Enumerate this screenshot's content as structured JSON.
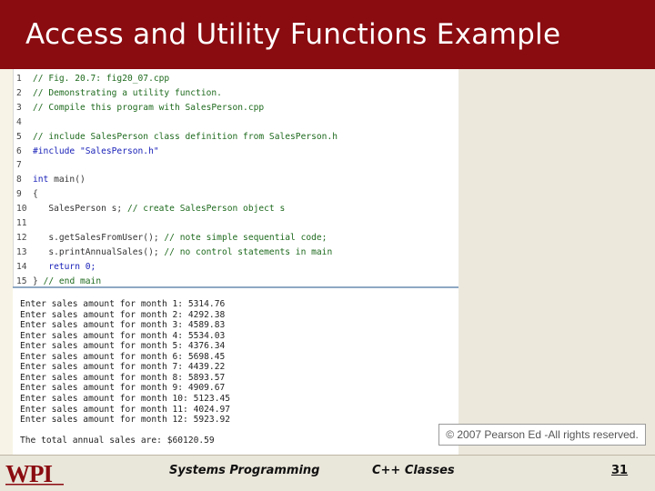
{
  "slide": {
    "title": "Access and Utility Functions Example"
  },
  "code": {
    "lines": [
      {
        "num": "1",
        "text": "// Fig. 20.7: fig20_07.cpp",
        "kind": "comment"
      },
      {
        "num": "2",
        "text": "// Demonstrating a utility function.",
        "kind": "comment"
      },
      {
        "num": "3",
        "text": "// Compile this program with SalesPerson.cpp",
        "kind": "comment"
      },
      {
        "num": "4",
        "text": "",
        "kind": "plain"
      },
      {
        "num": "5",
        "text": "// include SalesPerson class definition from SalesPerson.h",
        "kind": "comment"
      },
      {
        "num": "6",
        "text": "#include \"SalesPerson.h\"",
        "kind": "include"
      },
      {
        "num": "7",
        "text": "",
        "kind": "plain"
      },
      {
        "num": "8",
        "text": "int main()",
        "kind": "main"
      },
      {
        "num": "9",
        "text": "{",
        "kind": "plain"
      },
      {
        "num": "10",
        "text": "   SalesPerson s; // create SalesPerson object s",
        "kind": "decl"
      },
      {
        "num": "11",
        "text": "",
        "kind": "plain"
      },
      {
        "num": "12",
        "text": "   s.getSalesFromUser(); // note simple sequential code;",
        "kind": "call"
      },
      {
        "num": "13",
        "text": "   s.printAnnualSales(); // no control statements in main",
        "kind": "call"
      },
      {
        "num": "14",
        "text": "   return 0;",
        "kind": "return"
      },
      {
        "num": "15",
        "text": "} // end main",
        "kind": "end"
      }
    ]
  },
  "output": {
    "lines": [
      "Enter sales amount for month 1: 5314.76",
      "Enter sales amount for month 2: 4292.38",
      "Enter sales amount for month 3: 4589.83",
      "Enter sales amount for month 4: 5534.03",
      "Enter sales amount for month 5: 4376.34",
      "Enter sales amount for month 6: 5698.45",
      "Enter sales amount for month 7: 4439.22",
      "Enter sales amount for month 8: 5893.57",
      "Enter sales amount for month 9: 4909.67",
      "Enter sales amount for month 10: 5123.45",
      "Enter sales amount for month 11: 4024.97",
      "Enter sales amount for month 12: 5923.92",
      "",
      "The total annual sales are: $60120.59"
    ]
  },
  "copyright": "© 2007 Pearson Ed -All rights reserved.",
  "footer": {
    "logo_text": "WPI",
    "course": "Systems Programming",
    "topic": "C++ Classes",
    "page": "31"
  },
  "colors": {
    "title_bar": "#8a0b10",
    "comment": "#1e6a1e",
    "keyword": "#1a22b8",
    "logo": "#8a0b10"
  }
}
